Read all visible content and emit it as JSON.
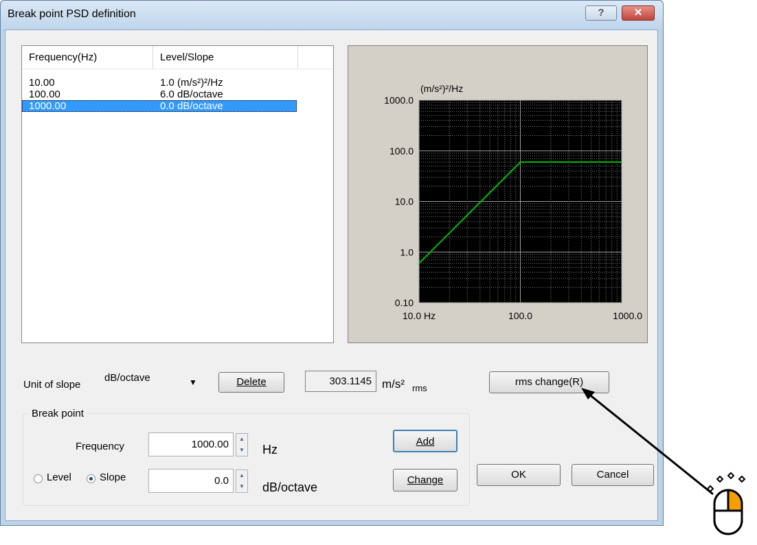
{
  "window": {
    "title": "Break point PSD definition",
    "help_glyph": "?",
    "close_glyph": "✕"
  },
  "list": {
    "columns": [
      "Frequency(Hz)",
      "Level/Slope"
    ],
    "rows": [
      {
        "frequency": "10.00",
        "value": "1.0 (m/s²)²/Hz",
        "selected": false
      },
      {
        "frequency": "100.00",
        "value": "6.0  dB/octave",
        "selected": false
      },
      {
        "frequency": "1000.00",
        "value": "0.0  dB/octave",
        "selected": true
      }
    ]
  },
  "chart_data": {
    "type": "line",
    "yunit_label": "(m/s²)²/Hz",
    "x_ticks": [
      "10.0 Hz",
      "100.0",
      "1000.0"
    ],
    "y_ticks": [
      "1000.0",
      "100.0",
      "10.0",
      "1.0",
      "0.10"
    ],
    "xlim": [
      10,
      1000
    ],
    "ylim": [
      0.1,
      1000
    ],
    "xscale": "log",
    "yscale": "log",
    "grid": true,
    "series": [
      {
        "x": [
          10,
          100,
          1000
        ],
        "y": [
          0.6,
          60,
          60
        ],
        "color": "#00c000"
      }
    ],
    "colors": {
      "background": "#000000",
      "grid": "#808080",
      "panel": "#d4d0c8"
    }
  },
  "controls": {
    "unit_of_slope_label": "Unit of slope",
    "unit_of_slope_value": "dB/octave",
    "delete_label": "Delete",
    "rms_value": "303.1145",
    "rms_unit": "m/s²",
    "rms_suffix": "rms",
    "rms_change_label": "rms change(R)",
    "breakpoint_group_label": "Break point",
    "frequency_label": "Frequency",
    "frequency_value": "1000.00",
    "frequency_unit": "Hz",
    "level_label": "Level",
    "slope_label": "Slope",
    "slope_value": "0.0",
    "slope_unit": "dB/octave",
    "add_label": "Add",
    "change_label": "Change",
    "ok_label": "OK",
    "cancel_label": "Cancel"
  },
  "colors": {
    "accent": "#3399ff",
    "cursor_highlight": "#f5a000"
  }
}
